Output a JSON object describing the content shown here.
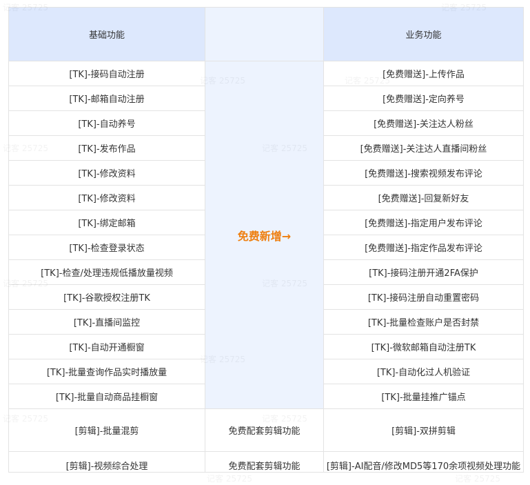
{
  "headers": {
    "basic": "基础功能",
    "middle": "",
    "business": "业务功能"
  },
  "middle_label": "免费新增→",
  "basic_rows": [
    "[TK]-接码自动注册",
    "[TK]-邮箱自动注册",
    "[TK]-自动养号",
    "[TK]-发布作品",
    "[TK]-修改资料",
    "[TK]-修改资料",
    "[TK]-绑定邮箱",
    "[TK]-检查登录状态",
    "[TK]-检查/处理违规低播放量视频",
    "[TK]-谷歌授权注册TK",
    "[TK]-直播间监控",
    "[TK]-自动开通橱窗",
    "[TK]-批量查询作品实时播放量",
    "[TK]-批量自动商品挂橱窗"
  ],
  "business_rows": [
    "[免费赠送]-上传作品",
    "[免费赠送]-定向养号",
    "[免费赠送]-关注达人粉丝",
    "[免费赠送]-关注达人直播间粉丝",
    "[免费赠送]-搜索视频发布评论",
    "[免费赠送]-回复新好友",
    "[免费赠送]-指定用户发布评论",
    "[免费赠送]-指定作品发布评论",
    "[TK]-接码注册开通2FA保护",
    "[TK]-接码注册自动重置密码",
    "[TK]-批量检查账户是否封禁",
    "[TK]-微软邮箱自动注册TK",
    "[TK]-自动化过人机验证",
    "[TK]-批量挂推广锚点"
  ],
  "edit_rows": [
    {
      "basic": "[剪辑]-批量混剪",
      "middle": "免费配套剪辑功能",
      "business": "[剪辑]-双拼剪辑"
    },
    {
      "basic": "[剪辑]-视频综合处理",
      "middle": "免费配套剪辑功能",
      "business": "[剪辑]-AI配音/修改MD5等170余项视频处理功能"
    }
  ],
  "watermark": "记客 25725",
  "colors": {
    "header_bg": "#dde8fd",
    "middle_bg": "#edf3fe",
    "accent": "#ee7f10",
    "border": "#e3e3e3"
  }
}
